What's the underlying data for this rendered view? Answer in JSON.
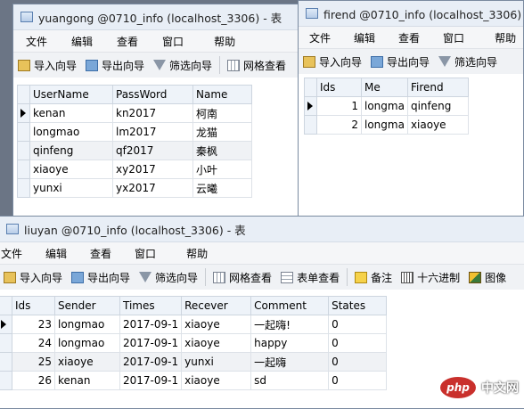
{
  "windows": {
    "yuangong": {
      "title": "yuangong @0710_info (localhost_3306) - 表",
      "menu": [
        "文件",
        "编辑",
        "查看",
        "窗口",
        "帮助"
      ],
      "toolbar": {
        "import": "导入向导",
        "export": "导出向导",
        "filter": "筛选向导",
        "gridview": "网格查看"
      },
      "columns": [
        "UserName",
        "PassWord",
        "Name"
      ],
      "rows": [
        [
          "kenan",
          "kn2017",
          "柯南"
        ],
        [
          "longmao",
          "lm2017",
          "龙猫"
        ],
        [
          "qinfeng",
          "qf2017",
          "秦枫"
        ],
        [
          "xiaoye",
          "xy2017",
          "小叶"
        ],
        [
          "yunxi",
          "yx2017",
          "云曦"
        ]
      ]
    },
    "firend": {
      "title": "firend @0710_info (localhost_3306) - 表",
      "menu": [
        "文件",
        "编辑",
        "查看",
        "窗口",
        "帮助"
      ],
      "toolbar": {
        "import": "导入向导",
        "export": "导出向导",
        "filter": "筛选向导"
      },
      "columns": [
        "Ids",
        "Me",
        "Firend"
      ],
      "rows": [
        [
          "1",
          "longma",
          "qinfeng"
        ],
        [
          "2",
          "longma",
          "xiaoye"
        ]
      ]
    },
    "liuyan": {
      "title": "liuyan @0710_info (localhost_3306) - 表",
      "menu": [
        "文件",
        "编辑",
        "查看",
        "窗口",
        "帮助"
      ],
      "toolbar": {
        "import": "导入向导",
        "export": "导出向导",
        "filter": "筛选向导",
        "gridview": "网格查看",
        "formview": "表单查看",
        "memo": "备注",
        "hex": "十六进制",
        "image": "图像"
      },
      "columns": [
        "Ids",
        "Sender",
        "Times",
        "Recever",
        "Comment",
        "States"
      ],
      "rows": [
        [
          "23",
          "longmao",
          "2017-09-1",
          "xiaoye",
          "一起嗨!",
          "0"
        ],
        [
          "24",
          "longmao",
          "2017-09-1",
          "xiaoye",
          "happy",
          "0"
        ],
        [
          "25",
          "xiaoye",
          "2017-09-1",
          "yunxi",
          "一起嗨",
          "0"
        ],
        [
          "26",
          "kenan",
          "2017-09-1",
          "xiaoye",
          "sd",
          "0"
        ]
      ]
    }
  },
  "watermark": {
    "logo": "php",
    "text": "中文网"
  }
}
